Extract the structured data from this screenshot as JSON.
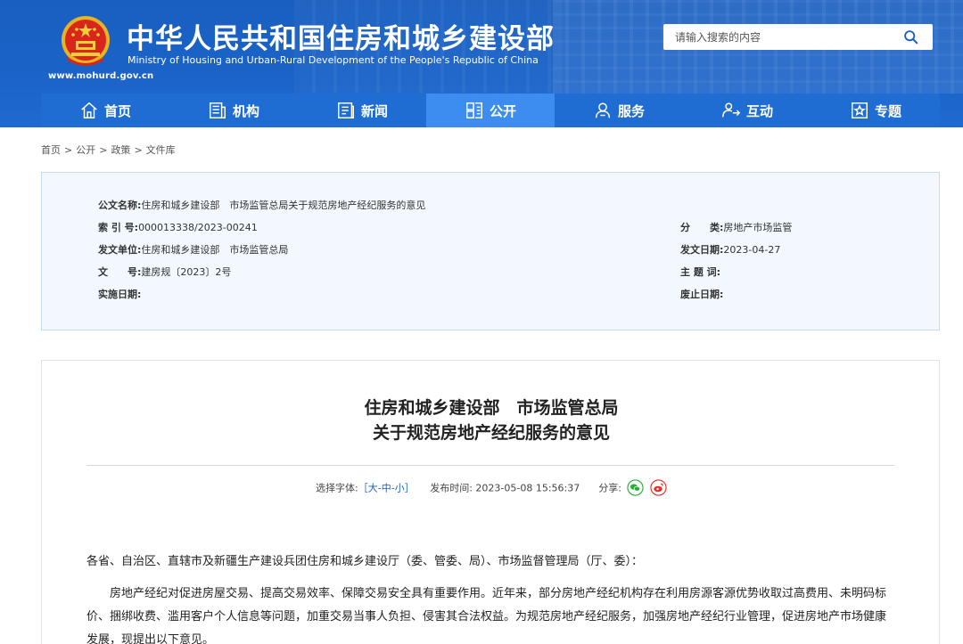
{
  "header": {
    "title": "中华人民共和国住房和城乡建设部",
    "subtitle": "Ministry of Housing and Urban-Rural Development of the People's Republic of China",
    "domain": "www.mohurd.gov.cn",
    "search_placeholder": "请输入搜索的内容"
  },
  "nav": {
    "items": [
      {
        "label": "首页",
        "icon": "home-icon"
      },
      {
        "label": "机构",
        "icon": "org-icon"
      },
      {
        "label": "新闻",
        "icon": "news-icon"
      },
      {
        "label": "公开",
        "icon": "open-icon",
        "active": true
      },
      {
        "label": "服务",
        "icon": "service-icon"
      },
      {
        "label": "互动",
        "icon": "interact-icon"
      },
      {
        "label": "专题",
        "icon": "topic-icon"
      }
    ]
  },
  "breadcrumb": [
    "首页",
    "公开",
    "政策",
    "文件库"
  ],
  "meta": {
    "doc_name_label": "公文名称:",
    "doc_name": "住房和城乡建设部　市场监管总局关于规范房地产经纪服务的意见",
    "index_label": "索 引 号:",
    "index": "000013338/2023-00241",
    "category_label": "分　　类:",
    "category": "房地产市场监管",
    "issuer_label": "发文单位:",
    "issuer": "住房和城乡建设部　市场监管总局",
    "issue_date_label": "发文日期:",
    "issue_date": "2023-04-27",
    "doc_no_label": "文　　号:",
    "doc_no": "建房规〔2023〕2号",
    "keywords_label": "主 题 词:",
    "keywords": "",
    "effective_label": "实施日期:",
    "effective": "",
    "expire_label": "废止日期:",
    "expire": ""
  },
  "article": {
    "title_line1": "住房和城乡建设部　市场监管总局",
    "title_line2": "关于规范房地产经纪服务的意见",
    "font_label": "选择字体:",
    "font_open": "［",
    "font_large": "大",
    "font_medium": "中",
    "font_small": "小",
    "font_close": "］",
    "publish_label": "发布时间:",
    "publish_time": "2023-05-08 15:56:37",
    "share_label": "分享:",
    "salutation": "各省、自治区、直辖市及新疆生产建设兵团住房和城乡建设厅（委、管委、局）、市场监督管理局（厅、委）：",
    "paragraph1": "房地产经纪对促进房屋交易、提高交易效率、保障交易安全具有重要作用。近年来，部分房地产经纪机构存在利用房源客源优势收取过高费用、未明码标价、捆绑收费、滥用客户个人信息等问题，加重交易当事人负担、侵害其合法权益。为规范房地产经纪服务，加强房地产经纪行业管理，促进房地产市场健康发展，现提出以下意见。"
  },
  "colors": {
    "header_blue": "#1b63c8",
    "nav_active": "#3d8df0",
    "meta_bg": "#f2f8fe",
    "wechat_green": "#2aae3a",
    "weibo_red": "#e0312b"
  }
}
